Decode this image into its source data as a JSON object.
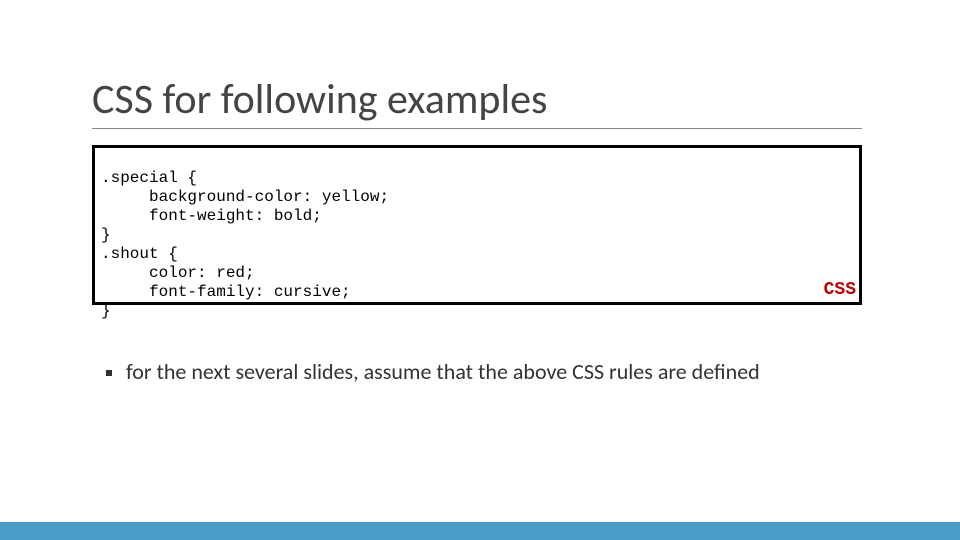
{
  "title": "CSS for following examples",
  "code_box": {
    "lines": [
      ".special {",
      "     background-color: yellow;",
      "     font-weight: bold;",
      "}",
      ".shout {",
      "     color: red;",
      "     font-family: cursive;",
      "}"
    ],
    "language_label": "CSS"
  },
  "bullets": [
    "for the next several slides, assume that the above CSS rules are defined"
  ],
  "accent_color": "#4b9cc7"
}
